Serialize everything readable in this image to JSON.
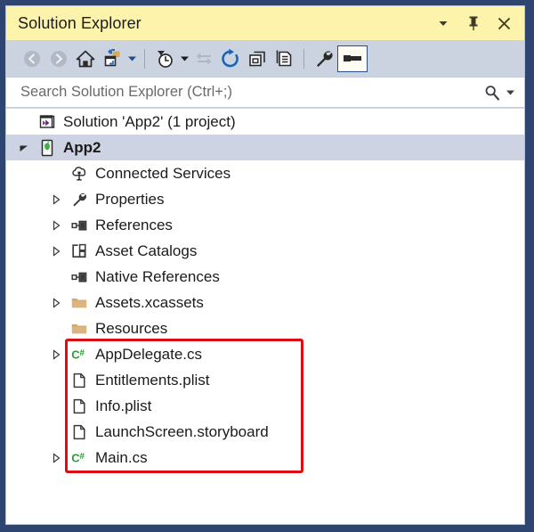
{
  "window": {
    "title": "Solution Explorer",
    "border_color": "#2e4471",
    "titlebar_color": "#fdf3ab",
    "toolbar_color": "#ccd3e0"
  },
  "title_buttons": [
    {
      "name": "dropdown-menu-button",
      "icon": "chevron-down-icon",
      "label": "▼"
    },
    {
      "name": "pin-button",
      "icon": "pin-icon",
      "label": "Pin"
    },
    {
      "name": "close-button",
      "icon": "close-icon",
      "label": "×"
    }
  ],
  "toolbar": {
    "items": [
      {
        "name": "back-button",
        "icon": "back-arrow-icon",
        "tooltip": "Back",
        "enabled": false
      },
      {
        "name": "forward-button",
        "icon": "forward-arrow-icon",
        "tooltip": "Forward",
        "enabled": false
      },
      {
        "name": "home-button",
        "icon": "home-icon",
        "tooltip": "Home",
        "enabled": true
      },
      {
        "name": "sync-with-active-document-button",
        "icon": "sync-folder-icon",
        "tooltip": "Sync with Active Document",
        "enabled": true
      },
      {
        "name": "pending-changes-filter-button",
        "icon": "clock-filter-icon",
        "tooltip": "Pending Changes Filter",
        "enabled": true
      },
      {
        "name": "sync-views-button",
        "icon": "sync-views-icon",
        "tooltip": "Sync Views",
        "enabled": false
      },
      {
        "name": "refresh-button",
        "icon": "refresh-icon",
        "tooltip": "Refresh",
        "enabled": true
      },
      {
        "name": "collapse-all-button",
        "icon": "collapse-all-icon",
        "tooltip": "Collapse All",
        "enabled": true
      },
      {
        "name": "show-all-files-button",
        "icon": "show-all-files-icon",
        "tooltip": "Show All Files",
        "enabled": true
      },
      {
        "name": "properties-button",
        "icon": "wrench-icon",
        "tooltip": "Properties",
        "enabled": true
      },
      {
        "name": "preview-selected-items-button",
        "icon": "preview-pane-icon",
        "tooltip": "Preview Selected Items",
        "enabled": true,
        "toggled": true
      }
    ]
  },
  "search": {
    "placeholder": "Search Solution Explorer (Ctrl+;)",
    "value": "",
    "icon": "search-icon",
    "dropdown_icon": "chevron-down-icon"
  },
  "tree": {
    "nodes": [
      {
        "label": "Solution 'App2' (1 project)",
        "icon": "visual-studio-solution-icon",
        "indent": 0,
        "expander": "none",
        "bold": false,
        "selected": false,
        "highlighted": false
      },
      {
        "label": "App2",
        "icon": "ios-app-project-icon",
        "indent": 0,
        "expander": "expanded",
        "bold": true,
        "selected": true,
        "highlighted": false
      },
      {
        "label": "Connected Services",
        "icon": "connected-services-icon",
        "indent": 1,
        "expander": "none",
        "bold": false,
        "selected": false,
        "highlighted": false
      },
      {
        "label": "Properties",
        "icon": "wrench-icon",
        "indent": 1,
        "expander": "collapsed",
        "bold": false,
        "selected": false,
        "highlighted": false
      },
      {
        "label": "References",
        "icon": "references-icon",
        "indent": 1,
        "expander": "collapsed",
        "bold": false,
        "selected": false,
        "highlighted": false
      },
      {
        "label": "Asset Catalogs",
        "icon": "asset-catalogs-icon",
        "indent": 1,
        "expander": "collapsed",
        "bold": false,
        "selected": false,
        "highlighted": false
      },
      {
        "label": "Native References",
        "icon": "references-icon",
        "indent": 1,
        "expander": "none",
        "bold": false,
        "selected": false,
        "highlighted": false
      },
      {
        "label": "Assets.xcassets",
        "icon": "folder-icon",
        "indent": 1,
        "expander": "collapsed",
        "bold": false,
        "selected": false,
        "highlighted": false
      },
      {
        "label": "Resources",
        "icon": "folder-icon",
        "indent": 1,
        "expander": "none",
        "bold": false,
        "selected": false,
        "highlighted": false
      },
      {
        "label": "AppDelegate.cs",
        "icon": "csharp-file-icon",
        "indent": 1,
        "expander": "collapsed",
        "bold": false,
        "selected": false,
        "highlighted": true
      },
      {
        "label": "Entitlements.plist",
        "icon": "generic-file-icon",
        "indent": 1,
        "expander": "none",
        "bold": false,
        "selected": false,
        "highlighted": true
      },
      {
        "label": "Info.plist",
        "icon": "generic-file-icon",
        "indent": 1,
        "expander": "none",
        "bold": false,
        "selected": false,
        "highlighted": true
      },
      {
        "label": "LaunchScreen.storyboard",
        "icon": "generic-file-icon",
        "indent": 1,
        "expander": "none",
        "bold": false,
        "selected": false,
        "highlighted": true
      },
      {
        "label": "Main.cs",
        "icon": "csharp-file-icon",
        "indent": 1,
        "expander": "collapsed",
        "bold": false,
        "selected": false,
        "highlighted": true
      }
    ]
  },
  "annotation": {
    "name": "red-highlight-rectangle",
    "color": "#dd0d11",
    "covers": [
      "AppDelegate.cs",
      "Entitlements.plist",
      "Info.plist",
      "LaunchScreen.storyboard",
      "Main.cs"
    ]
  }
}
